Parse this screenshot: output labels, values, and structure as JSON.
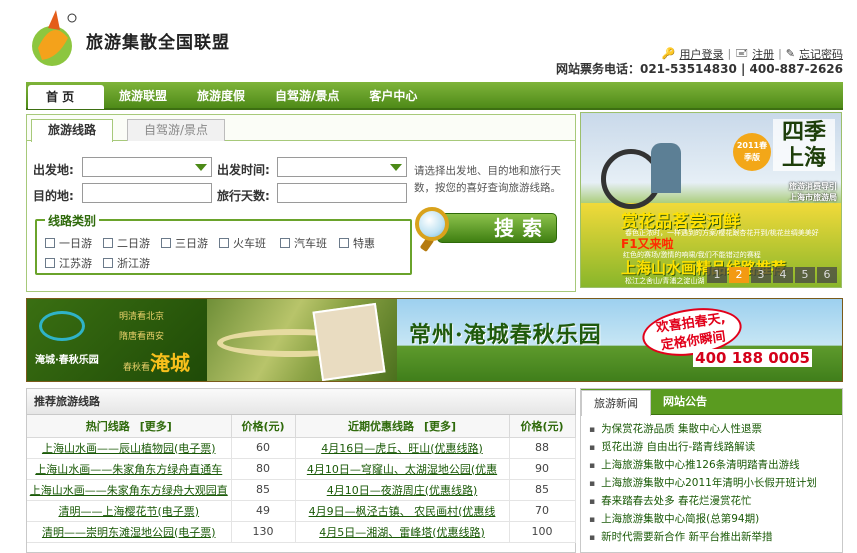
{
  "header": {
    "site_name": "旅游集散全国联盟",
    "links": [
      "用户登录",
      "注册",
      "忘记密码"
    ],
    "hotline": "网站票务电话：021-53514830 | 400-887-2626"
  },
  "nav": [
    "首  页",
    "旅游联盟",
    "旅游度假",
    "自驾游/景点",
    "客户中心"
  ],
  "search": {
    "tabs": [
      "旅游线路",
      "自驾游/景点"
    ],
    "depart_label": "出发地:",
    "time_label": "出发时间:",
    "dest_label": "目的地:",
    "days_label": "旅行天数:",
    "hint": "请选择出发地、目的地和旅行天数，按您的喜好查询旅游线路。",
    "category_title": "线路类别",
    "categories": [
      "一日游",
      "二日游",
      "三日游",
      "火车班",
      "汽车班",
      "特惠",
      "江苏游",
      "浙江游"
    ],
    "button": "搜索"
  },
  "promo": {
    "season": "四季上海",
    "badge": "2011春季版",
    "guide1": "旅游消费导引",
    "guide2": "上海市旅游局",
    "line1": "赏花品茗尝河鲜",
    "line1_sub": "春色正浓时，一样遇到的方案/樱花跟杏花开到/桃花丝绸美美好",
    "line2": "F1又来啦",
    "line2_sub": "红色的赛场/激情的响啸/我们不能错过的赛程",
    "line3": "上海山水画精品线路推荐",
    "line3_sub": "松江之舍山/青浦之淀山湖",
    "pager": [
      "1",
      "2",
      "3",
      "4",
      "5",
      "6"
    ],
    "active_page": "2"
  },
  "banner": {
    "poem1": "明清看北京",
    "poem2": "隋唐看西安",
    "poem3": "春秋看",
    "poem3_big": "淹城",
    "brand": "淹城·春秋乐园",
    "title": "常州·淹城春秋乐园",
    "bubble1": "欢喜拍春天,",
    "bubble2": "定格你瞬间",
    "phone": "400 188 0005"
  },
  "routes": {
    "title": "推荐旅游线路",
    "hot_header": "热门线路",
    "recent_header": "近期优惠线路",
    "more": "[更多]",
    "price_header": "价格(元)",
    "rows": [
      {
        "hot": "上海山水画——辰山植物园(电子票)",
        "hot_price": "60",
        "recent": "4月16日—虎丘、旺山(优惠线路)",
        "recent_price": "88"
      },
      {
        "hot": "上海山水画——朱家角东方绿舟直通车",
        "hot_price": "80",
        "recent": "4月10日—穹窿山、太湖湿地公园(优惠",
        "recent_price": "90"
      },
      {
        "hot": "上海山水画——朱家角东方绿舟大观园直",
        "hot_price": "85",
        "recent": "4月10日—夜游周庄(优惠线路)",
        "recent_price": "85"
      },
      {
        "hot": "清明——上海樱花节(电子票)",
        "hot_price": "49",
        "recent": "4月9日—枫泾古镇、 农民画村(优惠线",
        "recent_price": "70"
      },
      {
        "hot": "清明——崇明东滩湿地公园(电子票)",
        "hot_price": "130",
        "recent": "4月5日—湘湖、雷峰塔(优惠线路)",
        "recent_price": "100"
      }
    ]
  },
  "news": {
    "tabs": [
      "旅游新闻",
      "网站公告"
    ],
    "items": [
      "为保赏花游品质 集散中心人性退票",
      "觅花出游 自由出行-踏青线路解读",
      "上海旅游集散中心推126条清明踏青出游线",
      "上海旅游集散中心2011年清明小长假开班计划",
      "春来踏春去处多 春花烂漫赏花忙",
      "上海旅游集散中心简报(总第94期)",
      "新时代需要新合作 新平台推出新举措"
    ]
  }
}
